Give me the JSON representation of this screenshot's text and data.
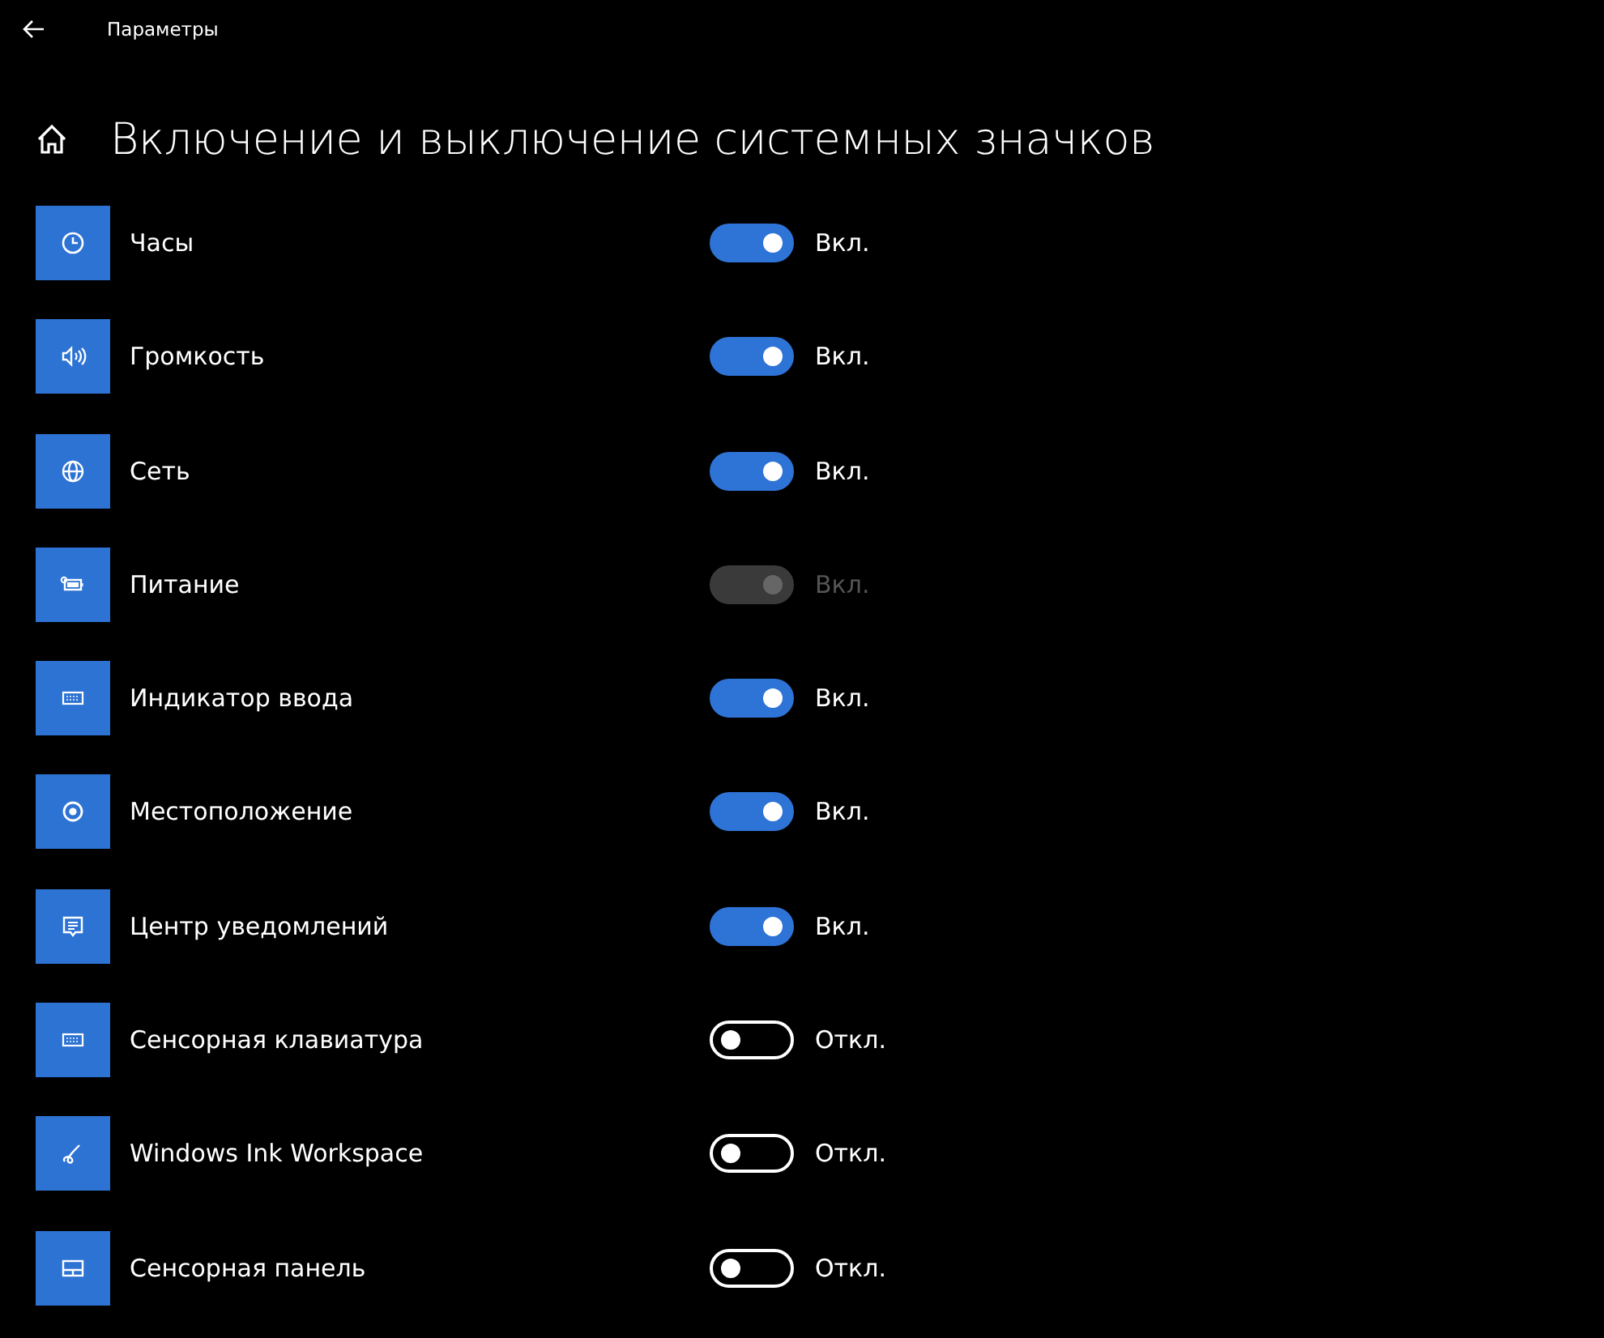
{
  "window": {
    "title": "Параметры"
  },
  "page": {
    "title": "Включение и выключение системных значков"
  },
  "items": [
    {
      "kind": "clock",
      "label": "Часы",
      "on": true,
      "disabled": false,
      "state": "Вкл."
    },
    {
      "kind": "volume",
      "label": "Громкость",
      "on": true,
      "disabled": false,
      "state": "Вкл."
    },
    {
      "kind": "globe",
      "label": "Сеть",
      "on": true,
      "disabled": false,
      "state": "Вкл."
    },
    {
      "kind": "battery",
      "label": "Питание",
      "on": true,
      "disabled": true,
      "state": "Вкл."
    },
    {
      "kind": "keyboard",
      "label": "Индикатор ввода",
      "on": true,
      "disabled": false,
      "state": "Вкл."
    },
    {
      "kind": "location",
      "label": "Местоположение",
      "on": true,
      "disabled": false,
      "state": "Вкл."
    },
    {
      "kind": "message",
      "label": "Центр уведомлений",
      "on": true,
      "disabled": false,
      "state": "Вкл."
    },
    {
      "kind": "keyboard",
      "label": "Сенсорная клавиатура",
      "on": false,
      "disabled": false,
      "state": "Откл."
    },
    {
      "kind": "pen",
      "label": "Windows Ink Workspace",
      "on": false,
      "disabled": false,
      "state": "Откл."
    },
    {
      "kind": "touchpad",
      "label": "Сенсорная панель",
      "on": false,
      "disabled": false,
      "state": "Откл."
    }
  ]
}
